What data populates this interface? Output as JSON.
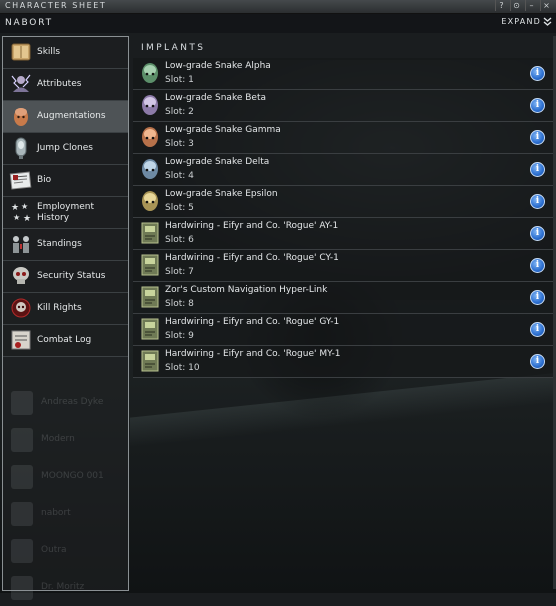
{
  "window": {
    "title": "CHARACTER SHEET",
    "controls": [
      "?",
      "⊙",
      "–",
      "×"
    ]
  },
  "header": {
    "character_name": "NABORT",
    "expand_label": "EXPAND"
  },
  "sidebar": {
    "items": [
      {
        "label": "Skills",
        "icon": "book-icon",
        "active": false
      },
      {
        "label": "Attributes",
        "icon": "lightning-figure-icon",
        "active": false
      },
      {
        "label": "Augmentations",
        "icon": "brain-head-icon",
        "active": true
      },
      {
        "label": "Jump Clones",
        "icon": "clone-pod-icon",
        "active": false
      },
      {
        "label": "Bio",
        "icon": "newspaper-icon",
        "active": false
      },
      {
        "label": "Employment History",
        "label_line1": "Employment",
        "label_line2": "History",
        "icon": "stars-icon",
        "active": false
      },
      {
        "label": "Standings",
        "icon": "standings-figures-icon",
        "active": false
      },
      {
        "label": "Security Status",
        "icon": "skull-icon",
        "active": false
      },
      {
        "label": "Kill Rights",
        "icon": "kill-rights-icon",
        "active": false
      },
      {
        "label": "Combat Log",
        "icon": "combat-log-icon",
        "active": false
      }
    ],
    "ghost_list": [
      "Andreas Dyke",
      "Modern",
      "MOONGO 001",
      "nabort",
      "Outra",
      "Dr. Moritz"
    ]
  },
  "main": {
    "section_title": "IMPLANTS",
    "implants": [
      {
        "name": "Low-grade Snake Alpha",
        "slot": "Slot: 1",
        "icon": "implant-head-green-icon"
      },
      {
        "name": "Low-grade Snake Beta",
        "slot": "Slot: 2",
        "icon": "implant-head-purple-icon"
      },
      {
        "name": "Low-grade Snake Gamma",
        "slot": "Slot: 3",
        "icon": "implant-head-orange-icon"
      },
      {
        "name": "Low-grade Snake Delta",
        "slot": "Slot: 4",
        "icon": "implant-head-blue-icon"
      },
      {
        "name": "Low-grade Snake Epsilon",
        "slot": "Slot: 5",
        "icon": "implant-head-gold-icon"
      },
      {
        "name": "Hardwiring - Eifyr and Co. 'Rogue' AY-1",
        "slot": "Slot: 6",
        "icon": "hardwiring-chip-icon"
      },
      {
        "name": "Hardwiring - Eifyr and Co. 'Rogue' CY-1",
        "slot": "Slot: 7",
        "icon": "hardwiring-chip-icon"
      },
      {
        "name": "Zor's Custom Navigation Hyper-Link",
        "slot": "Slot: 8",
        "icon": "hardwiring-chip-icon"
      },
      {
        "name": "Hardwiring - Eifyr and Co. 'Rogue' GY-1",
        "slot": "Slot: 9",
        "icon": "hardwiring-chip-icon"
      },
      {
        "name": "Hardwiring - Eifyr and Co. 'Rogue' MY-1",
        "slot": "Slot: 10",
        "icon": "hardwiring-chip-icon"
      }
    ]
  },
  "colors": {
    "info_button": "#2c6fd0",
    "active_nav": "#4e5356",
    "sidebar_border": "#8a9093"
  }
}
